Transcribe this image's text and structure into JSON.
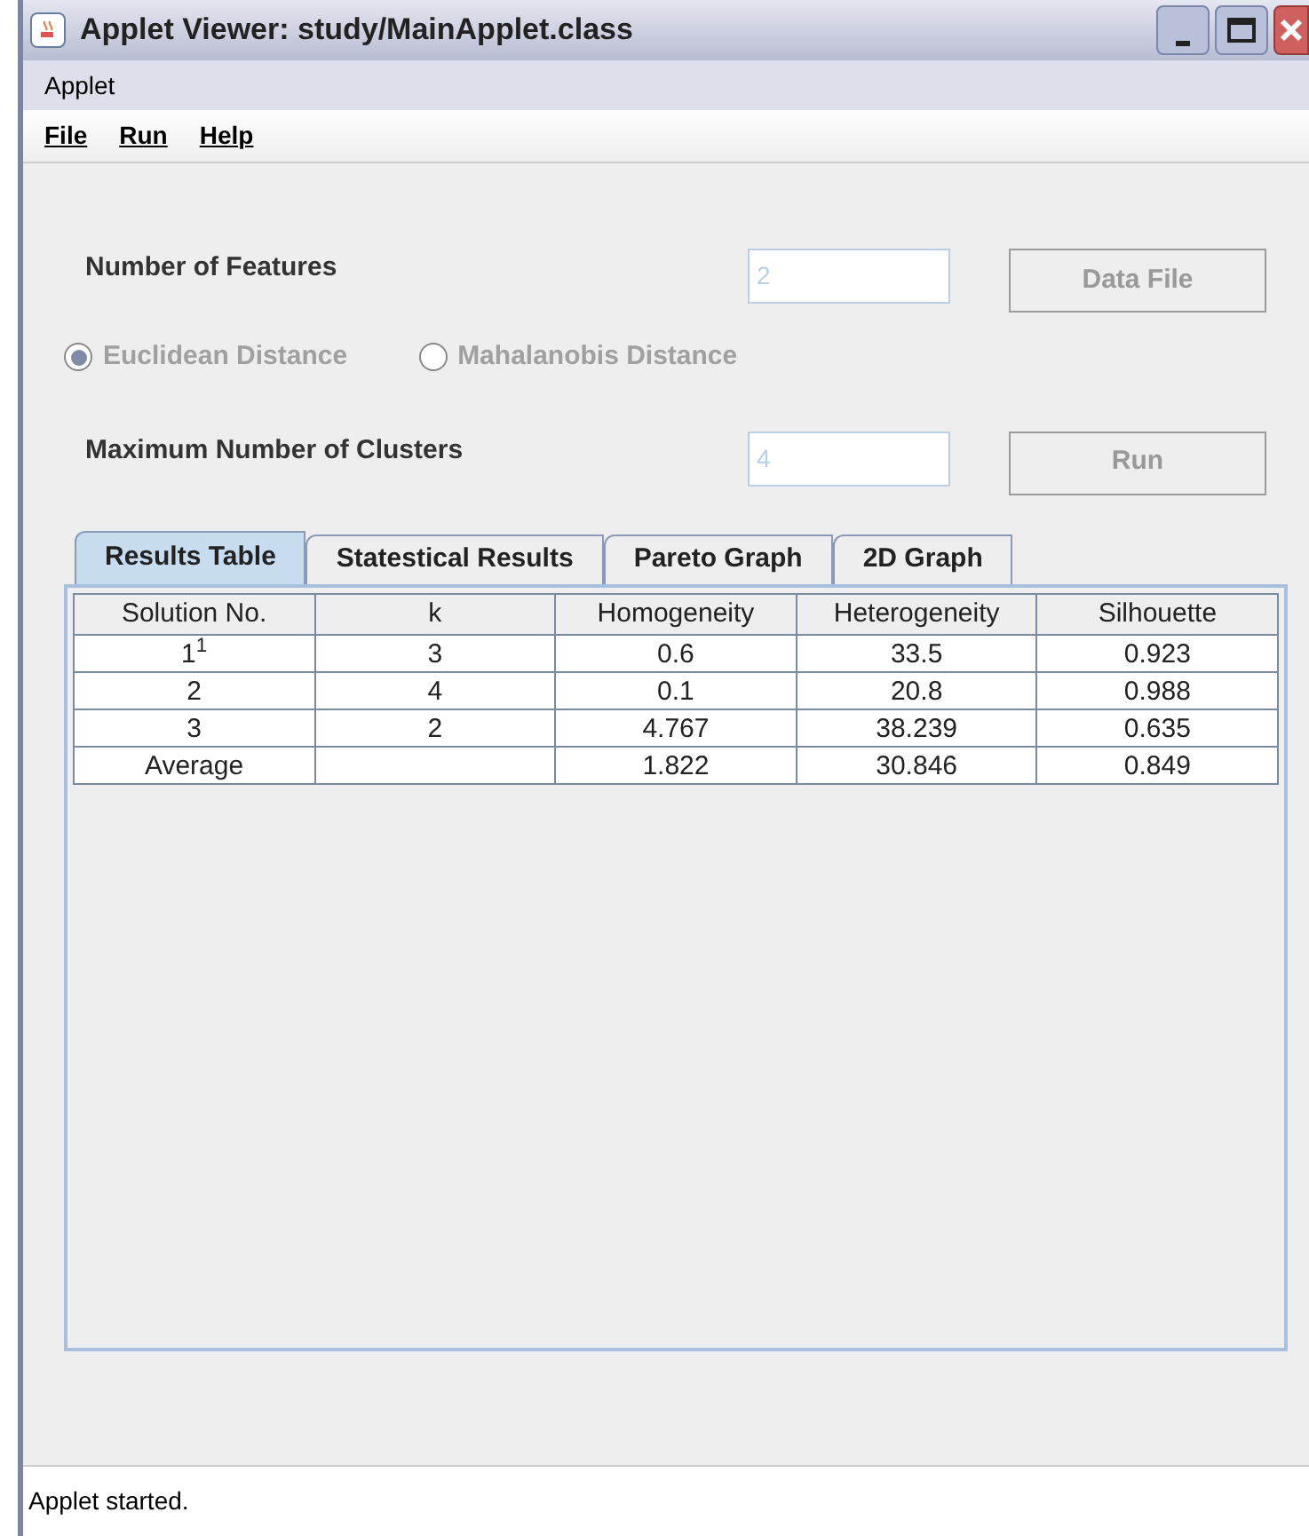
{
  "window": {
    "title": "Applet Viewer: study/MainApplet.class"
  },
  "applet_menu": "Applet",
  "menus": [
    {
      "label": "File"
    },
    {
      "label": "Run"
    },
    {
      "label": "Help"
    }
  ],
  "features": {
    "label": "Number of Features",
    "value": "2",
    "disabled": true,
    "button": "Data File",
    "button_disabled": true
  },
  "distance": [
    {
      "label": "Euclidean Distance",
      "selected": true,
      "disabled": true
    },
    {
      "label": "Mahalanobis Distance",
      "selected": false,
      "disabled": true
    }
  ],
  "clusters": {
    "label": "Maximum Number of Clusters",
    "value": "4",
    "disabled": true,
    "button": "Run",
    "button_disabled": true
  },
  "tabs": [
    {
      "label": "Results Table",
      "selected": true
    },
    {
      "label": "Statestical Results",
      "selected": false
    },
    {
      "label": "Pareto Graph",
      "selected": false
    },
    {
      "label": "2D Graph",
      "selected": false
    }
  ],
  "table": {
    "columns": [
      "Solution No.",
      "k",
      "Homogeneity",
      "Heterogeneity",
      "Silhouette"
    ],
    "rows": [
      [
        "1$^{1}$",
        "3",
        "0.6",
        "33.5",
        "0.923"
      ],
      [
        "2",
        "4",
        "0.1",
        "20.8",
        "0.988"
      ],
      [
        "3",
        "2",
        "4.767",
        "38.239",
        "0.635"
      ],
      [
        "Average",
        "",
        "1.822",
        "30.846",
        "0.849"
      ]
    ]
  },
  "status_bar": "Applet started."
}
